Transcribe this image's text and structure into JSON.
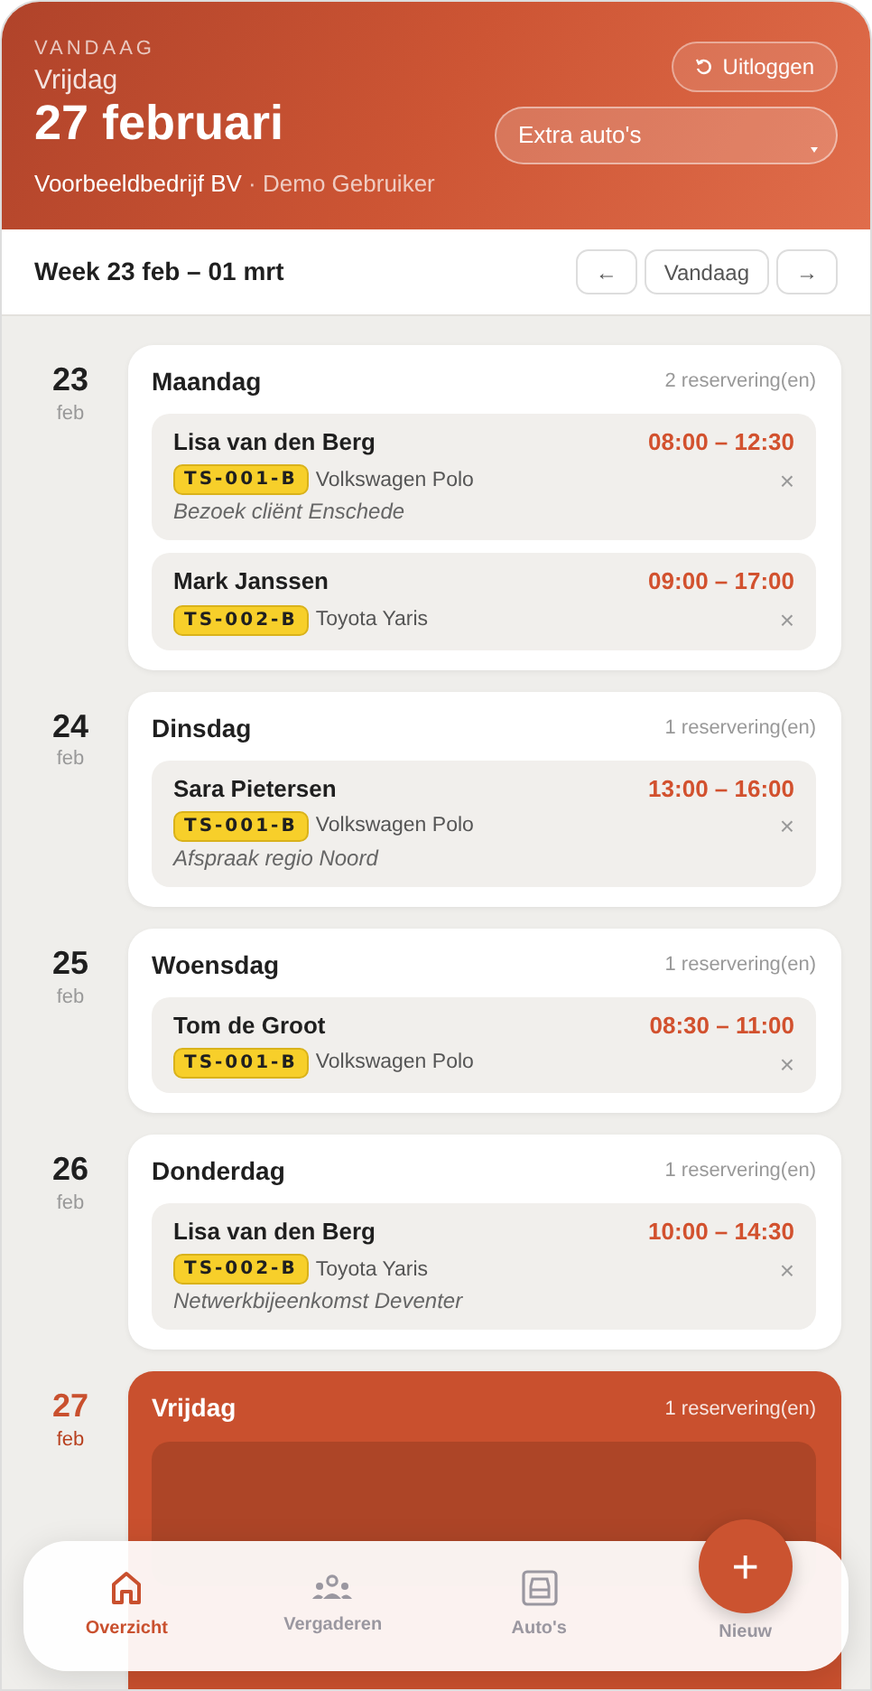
{
  "header": {
    "eyebrow": "VANDAAG",
    "weekday": "Vrijdag",
    "date": "27 februari",
    "company": "Voorbeeldbedrijf BV",
    "separator": "·",
    "user": "Demo Gebruiker",
    "logout": "Uitloggen",
    "select": "Extra auto's"
  },
  "week": {
    "title": "Week 23 feb – 01 mrt",
    "prev": "←",
    "today": "Vandaag",
    "next": "→"
  },
  "days": [
    {
      "day": "23",
      "month": "feb",
      "weekday": "Maandag",
      "count": "2 reservering(en)",
      "today": false,
      "reservations": [
        {
          "name": "Lisa van den Berg",
          "time": "08:00 – 12:30",
          "plate": "TS-001-B",
          "car": "Volkswagen Polo",
          "note": "Bezoek cliënt Enschede",
          "remove": "×"
        },
        {
          "name": "Mark Janssen",
          "time": "09:00 – 17:00",
          "plate": "TS-002-B",
          "car": "Toyota Yaris",
          "remove": "×"
        }
      ]
    },
    {
      "day": "24",
      "month": "feb",
      "weekday": "Dinsdag",
      "count": "1 reservering(en)",
      "today": false,
      "reservations": [
        {
          "name": "Sara Pietersen",
          "time": "13:00 – 16:00",
          "plate": "TS-001-B",
          "car": "Volkswagen Polo",
          "note": "Afspraak regio Noord",
          "remove": "×"
        }
      ]
    },
    {
      "day": "25",
      "month": "feb",
      "weekday": "Woensdag",
      "count": "1 reservering(en)",
      "today": false,
      "reservations": [
        {
          "name": "Tom de Groot",
          "time": "08:30 – 11:00",
          "plate": "TS-001-B",
          "car": "Volkswagen Polo",
          "remove": "×"
        }
      ]
    },
    {
      "day": "26",
      "month": "feb",
      "weekday": "Donderdag",
      "count": "1 reservering(en)",
      "today": false,
      "reservations": [
        {
          "name": "Lisa van den Berg",
          "time": "10:00 – 14:30",
          "plate": "TS-002-B",
          "car": "Toyota Yaris",
          "note": "Netwerkbijeenkomst Deventer",
          "remove": "×"
        }
      ]
    },
    {
      "day": "27",
      "month": "feb",
      "weekday": "Vrijdag",
      "count": "1 reservering(en)",
      "today": true
    }
  ],
  "nav": [
    {
      "kind": "home",
      "label": "Overzicht",
      "selected": true
    },
    {
      "kind": "people",
      "label": "Vergaderen",
      "selected": false
    },
    {
      "kind": "car",
      "label": "Auto's",
      "selected": false
    },
    {
      "kind": "add",
      "label": "Nieuw",
      "fab": "+",
      "selected": false
    }
  ]
}
